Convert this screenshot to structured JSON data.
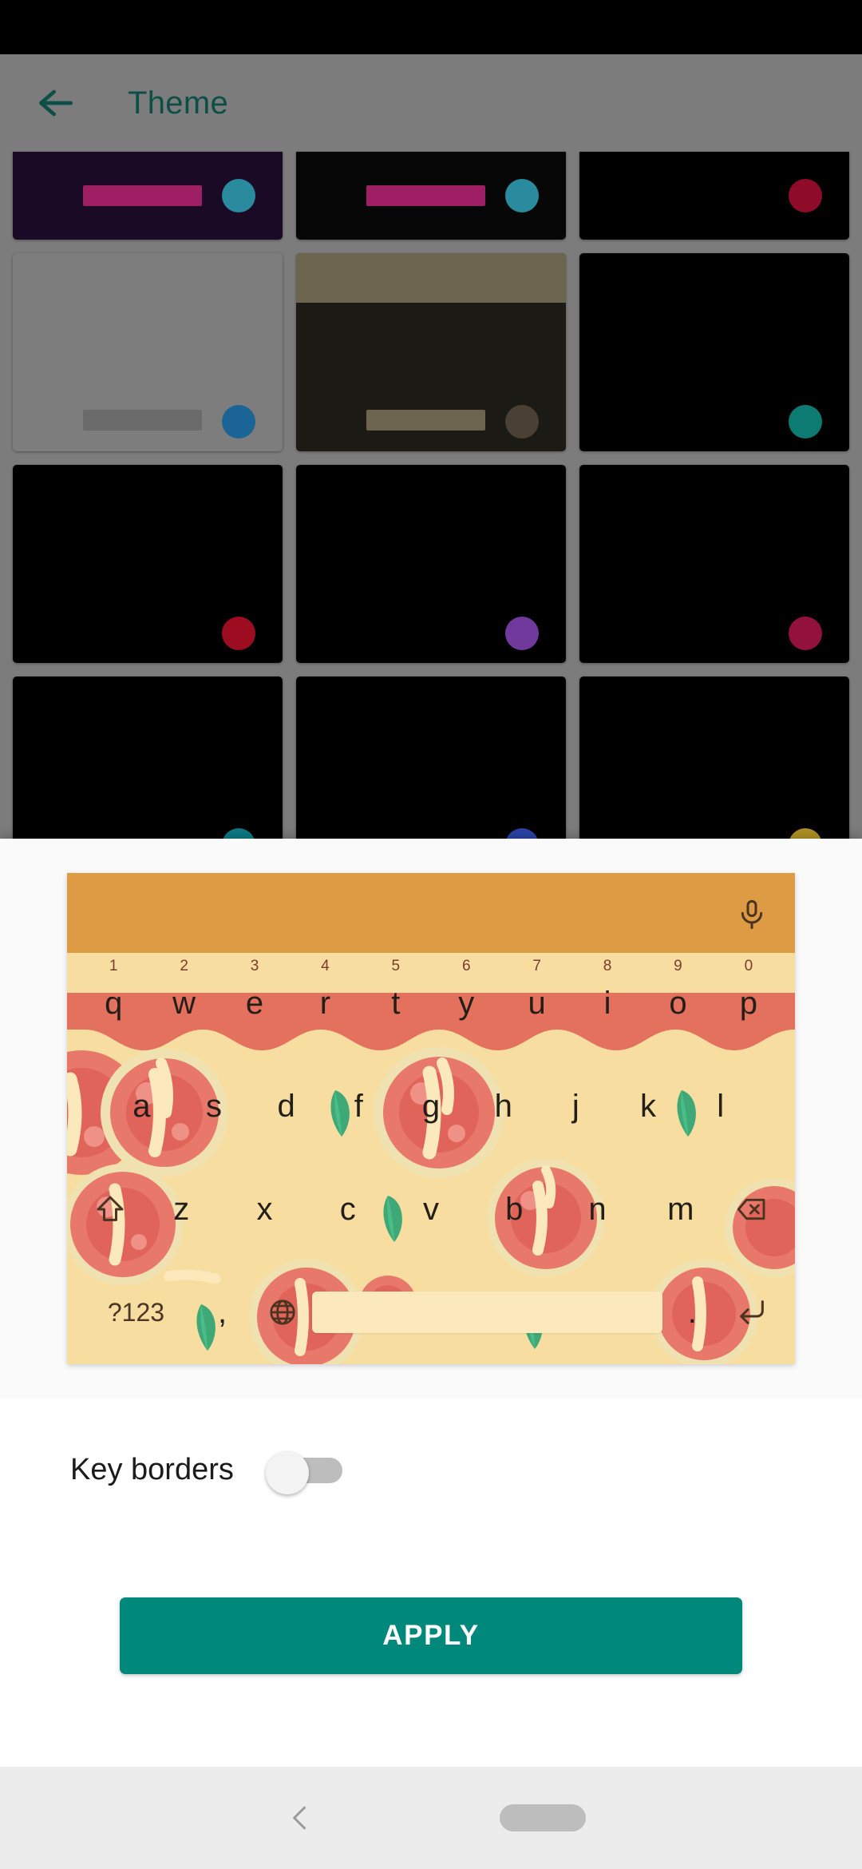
{
  "app": {
    "screen_title": "Theme",
    "back_icon": "arrow-left-icon",
    "title_color": "#0d4f47"
  },
  "theme_grid": {
    "tiles": [
      {
        "bg": "#1a0a26",
        "bar": "#9e1f63",
        "dot": "#2a8a9e",
        "partial": true
      },
      {
        "bg": "#070707",
        "bar": "#9e1f63",
        "dot": "#2a8a9e",
        "partial": true
      },
      {
        "bg": "#000000",
        "bar": "#000000",
        "dot": "#8e0b2a",
        "partial": true
      },
      {
        "bg": "#7d7d7d",
        "bar": "#6b6b6b",
        "dot": "#1a6496",
        "partial": false
      },
      {
        "bg": "#1c1a14",
        "top": "#6d6450",
        "bar": "#6d6450",
        "dot": "#4a4033",
        "partial": false
      },
      {
        "bg": "#000000",
        "bar": "#000000",
        "dot": "#0e7b73",
        "partial": false
      },
      {
        "bg": "#000000",
        "bar": "#000000",
        "dot": "#9c0d22",
        "partial": false
      },
      {
        "bg": "#000000",
        "bar": "#000000",
        "dot": "#70399c",
        "partial": false
      },
      {
        "bg": "#000000",
        "bar": "#000000",
        "dot": "#93113d",
        "partial": false
      },
      {
        "bg": "#000000",
        "bar": "#000000",
        "dot": "#0e7b85",
        "partial": false
      },
      {
        "bg": "#000000",
        "bar": "#000000",
        "dot": "#2b44a8",
        "partial": false
      },
      {
        "bg": "#000000",
        "bar": "#000000",
        "dot": "#b09326",
        "partial": false
      }
    ]
  },
  "keyboard_preview": {
    "theme_name": "pizza",
    "toolbar_color": "#dd9c44",
    "sauce_color": "#e4705e",
    "crust_color": "#f7dda0",
    "spacebar_color": "#fbe9bb",
    "key_text_color": "#231f18",
    "number_hint_color": "#7c3b2e",
    "mic_icon": "microphone-icon",
    "row1": [
      {
        "key": "q",
        "num": "1"
      },
      {
        "key": "w",
        "num": "2"
      },
      {
        "key": "e",
        "num": "3"
      },
      {
        "key": "r",
        "num": "4"
      },
      {
        "key": "t",
        "num": "5"
      },
      {
        "key": "y",
        "num": "6"
      },
      {
        "key": "u",
        "num": "7"
      },
      {
        "key": "i",
        "num": "8"
      },
      {
        "key": "o",
        "num": "9"
      },
      {
        "key": "p",
        "num": "0"
      }
    ],
    "row2": [
      "a",
      "s",
      "d",
      "f",
      "g",
      "h",
      "j",
      "k",
      "l"
    ],
    "row3": {
      "shift_icon": "shift-up-arrow-icon",
      "keys": [
        "z",
        "x",
        "c",
        "v",
        "b",
        "n",
        "m"
      ],
      "backspace_icon": "backspace-delete-icon"
    },
    "row4": {
      "symbols_label": "?123",
      "comma": ",",
      "globe_icon": "globe-language-icon",
      "space": "",
      "period": ".",
      "enter_icon": "enter-return-icon"
    }
  },
  "settings": {
    "key_borders_label": "Key borders",
    "key_borders_enabled": false
  },
  "actions": {
    "apply_label": "APPLY",
    "apply_color": "#00897b"
  },
  "navbar": {
    "back_icon": "chevron-left-icon",
    "home_icon": "home-pill-icon"
  }
}
